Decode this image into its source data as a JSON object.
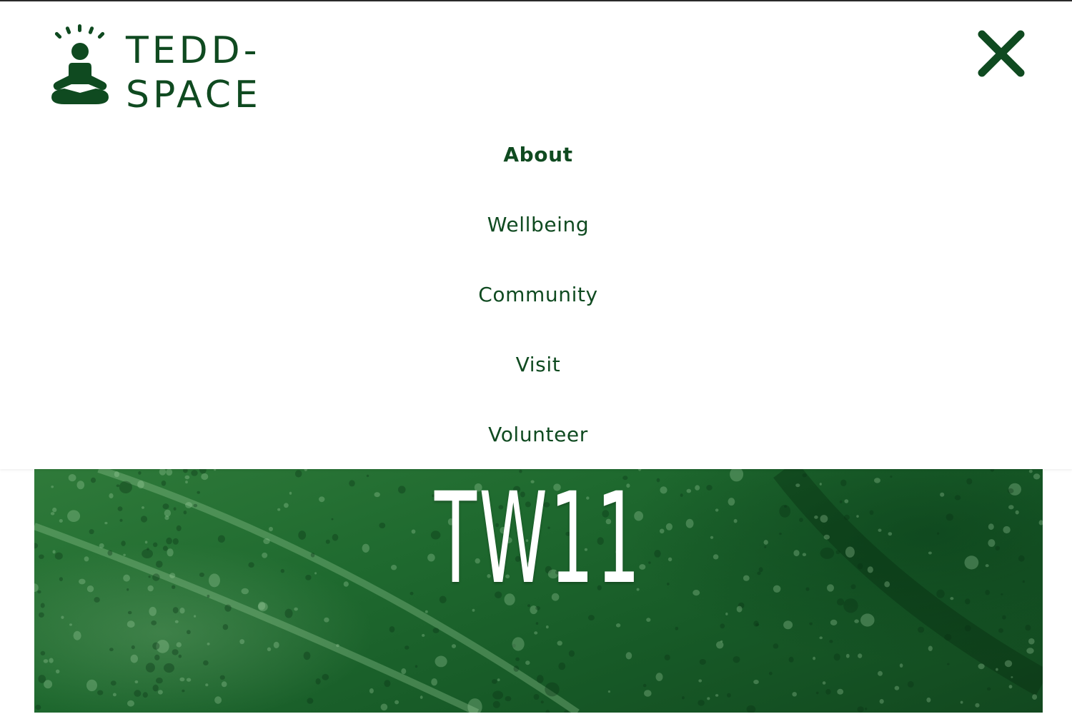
{
  "header": {
    "logo": {
      "icon": "meditating-person-icon",
      "line1": "TEDD-",
      "line2": "SPACE"
    },
    "close_icon": "close-icon"
  },
  "nav": {
    "items": [
      {
        "label": "About",
        "active": true
      },
      {
        "label": "Wellbeing",
        "active": false
      },
      {
        "label": "Community",
        "active": false
      },
      {
        "label": "Visit",
        "active": false
      },
      {
        "label": "Volunteer",
        "active": false
      }
    ]
  },
  "hero": {
    "title": "TW11"
  },
  "colors": {
    "brand_green": "#0f4a20",
    "hero_green": "#1f6a2f",
    "background": "#ffffff"
  }
}
